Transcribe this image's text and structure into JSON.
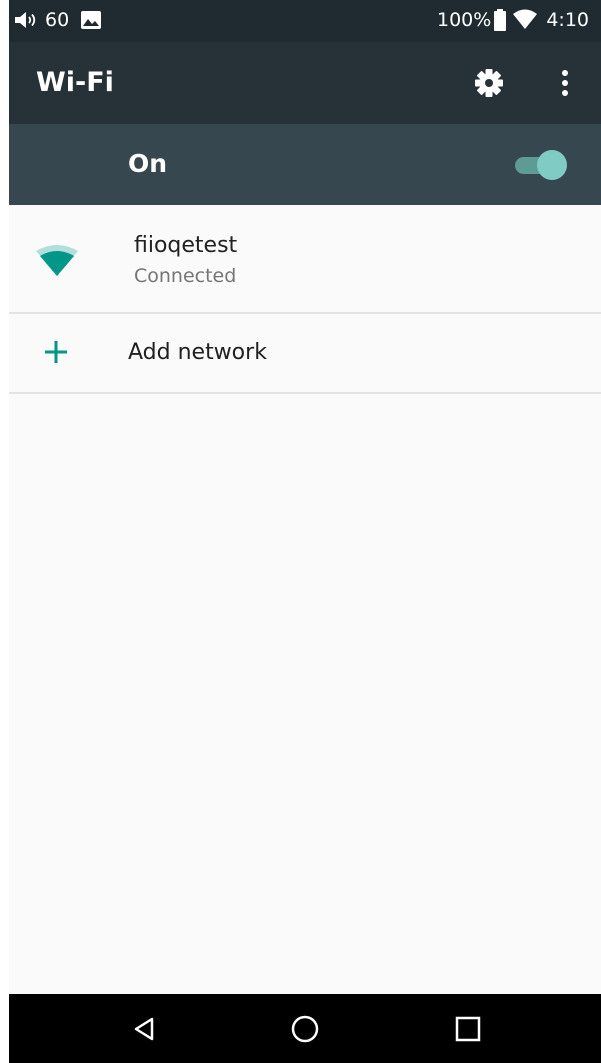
{
  "status_bar": {
    "volume_icon": "volume-icon",
    "volume_level": "60",
    "image_icon": "image-icon",
    "battery_percent": "100%",
    "battery_icon": "battery-icon",
    "wifi_icon": "wifi-status-icon",
    "time": "4:10"
  },
  "app_bar": {
    "title": "Wi-Fi",
    "settings_icon": "gear-icon",
    "overflow_icon": "more-vert-icon"
  },
  "master_switch": {
    "label": "On",
    "checked": true
  },
  "networks": [
    {
      "name": "fiioqetest",
      "status": "Connected",
      "icon": "wifi-signal-icon"
    }
  ],
  "add_network": {
    "label": "Add network",
    "icon": "plus-icon"
  },
  "nav_bar": {
    "back_icon": "back-icon",
    "home_icon": "home-icon",
    "recents_icon": "recents-icon"
  },
  "colors": {
    "status_bar": "#1f2b30",
    "app_bar": "#263238",
    "switch_bar": "#37474f",
    "accent": "#009688",
    "toggle_thumb": "#80cbc4",
    "background": "#fafafa"
  }
}
